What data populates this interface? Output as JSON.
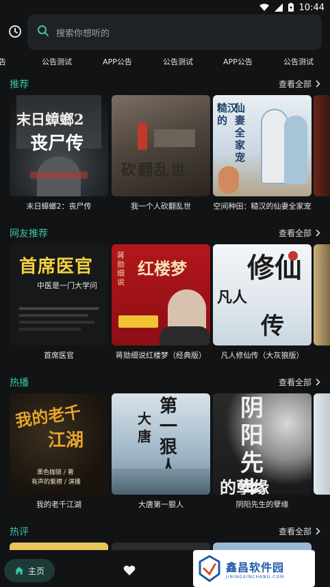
{
  "status_bar": {
    "time": "10:44"
  },
  "search": {
    "placeholder": "搜索你想听的"
  },
  "tabs": [
    "告",
    "公告测试",
    "APP公告",
    "公告测试",
    "APP公告",
    "公告测试"
  ],
  "sections": [
    {
      "title": "推荐",
      "see_all": "查看全部",
      "books": [
        {
          "title": "末日蟑螂2：丧尸传",
          "cover_text": [
            "末日蟑螂2",
            "丧尸传"
          ]
        },
        {
          "title": "我一个人砍翻乱世",
          "cover_text": [
            "砍翻乱世"
          ]
        },
        {
          "title": "空间种田：糙汉的仙妻全家宠",
          "cover_text": [
            "仙妻全家宠",
            "糙汉的"
          ]
        }
      ]
    },
    {
      "title": "网友推荐",
      "see_all": "查看全部",
      "books": [
        {
          "title": "首席医官",
          "cover_text": [
            "首席医官",
            "中医是一门大学问"
          ]
        },
        {
          "title": "蒋勋细说红楼梦（经典版）",
          "cover_text": [
            "红楼梦",
            "蒋勋细说"
          ]
        },
        {
          "title": "凡人修仙传（大灰狼版）",
          "cover_text": [
            "修仙",
            "凡人",
            "传"
          ]
        }
      ]
    },
    {
      "title": "热播",
      "see_all": "查看全部",
      "books": [
        {
          "title": "我的老千江湖",
          "cover_text": [
            "我的老千",
            "江湖",
            "黑色枷锁 / 著",
            "有声的紫襟 / 演播"
          ]
        },
        {
          "title": "大唐第一狠人",
          "cover_text": [
            "第一狠人",
            "大唐"
          ]
        },
        {
          "title": "阴阳先生的孽缘",
          "cover_text": [
            "阴阳先生",
            "的孽缘"
          ]
        }
      ]
    },
    {
      "title": "热评",
      "see_all": "查看全部",
      "books": []
    }
  ],
  "bottom_nav": {
    "home_label": "主页"
  },
  "watermark": {
    "main": "鑫昌软件园",
    "sub": "JININGXINCHANG.COM"
  },
  "colors": {
    "accent": "#3cc4a8",
    "background": "#111315",
    "search_bg": "#1f2224"
  }
}
